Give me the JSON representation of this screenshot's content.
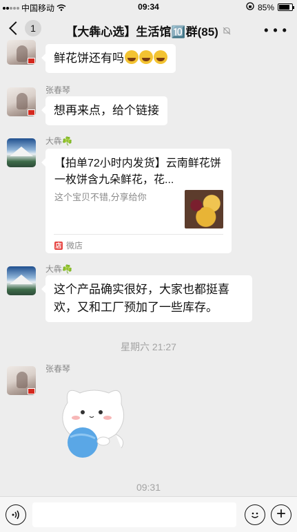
{
  "status_bar": {
    "carrier": "中国移动",
    "time": "09:34",
    "battery": "85%",
    "battery_level": 0.85
  },
  "nav": {
    "back_count": "1",
    "title": "【大犇心选】生活馆🔟群(85)",
    "mute_icon": "bell-off-icon",
    "more_icon": "more-dots-icon"
  },
  "messages": [
    {
      "type": "text",
      "sender": "",
      "text": "鲜花饼还有吗",
      "emoji_count": 3
    },
    {
      "type": "text",
      "sender": "张春琴",
      "text": "想再来点，给个链接"
    },
    {
      "type": "card",
      "sender": "大犇☘️",
      "title": "【拍单72小时内发货】云南鲜花饼一枚饼含九朵鲜花，花...",
      "desc": "这个宝贝不错,分享给你",
      "source": "微店"
    },
    {
      "type": "text",
      "sender": "大犇☘️",
      "line1": "这个产品确实很好，大家也都挺喜",
      "line2": "欢，又和工厂预加了一些库存。"
    },
    {
      "type": "time",
      "text": "星期六 21:27"
    },
    {
      "type": "sticker",
      "sender": "张春琴"
    },
    {
      "type": "time",
      "text": "09:31"
    }
  ],
  "input_bar": {
    "voice_icon": "voice-icon",
    "emoji_icon": "emoji-icon",
    "plus_icon": "plus-icon",
    "placeholder": ""
  },
  "colors": {
    "background": "#ededed",
    "bubble": "#ffffff",
    "meta_text": "#8a8a8a"
  }
}
